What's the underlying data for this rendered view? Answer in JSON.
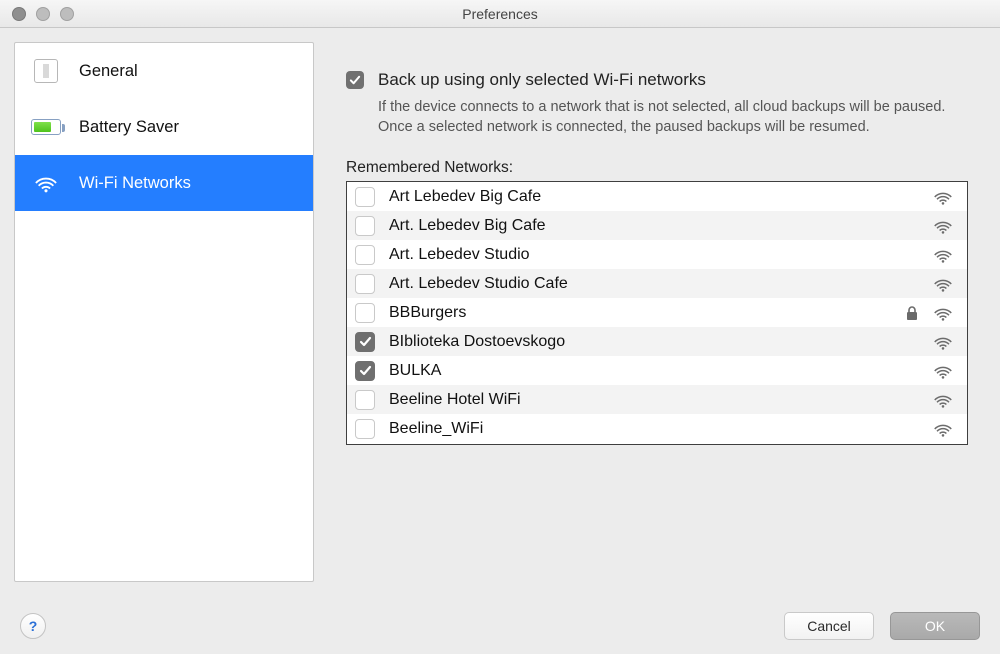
{
  "window": {
    "title": "Preferences"
  },
  "sidebar": {
    "items": [
      {
        "label": "General"
      },
      {
        "label": "Battery Saver"
      },
      {
        "label": "Wi-Fi Networks"
      }
    ],
    "active_index": 2
  },
  "pane": {
    "option_label": "Back up using only selected Wi-Fi networks",
    "option_checked": true,
    "option_desc": "If the device connects to a network that is not selected, all cloud backups will be paused. Once a selected network is connected, the paused backups will be resumed.",
    "list_label": "Remembered Networks:",
    "networks": [
      {
        "name": "Art Lebedev Big Cafe",
        "checked": false,
        "locked": false
      },
      {
        "name": "Art. Lebedev Big Cafe",
        "checked": false,
        "locked": false
      },
      {
        "name": "Art. Lebedev Studio",
        "checked": false,
        "locked": false
      },
      {
        "name": "Art. Lebedev Studio Cafe",
        "checked": false,
        "locked": false
      },
      {
        "name": "BBBurgers",
        "checked": false,
        "locked": true
      },
      {
        "name": "BIblioteka Dostoevskogo",
        "checked": true,
        "locked": false
      },
      {
        "name": "BULKA",
        "checked": true,
        "locked": false
      },
      {
        "name": "Beeline Hotel WiFi",
        "checked": false,
        "locked": false
      },
      {
        "name": "Beeline_WiFi",
        "checked": false,
        "locked": false
      }
    ]
  },
  "footer": {
    "help": "?",
    "cancel": "Cancel",
    "ok": "OK"
  }
}
